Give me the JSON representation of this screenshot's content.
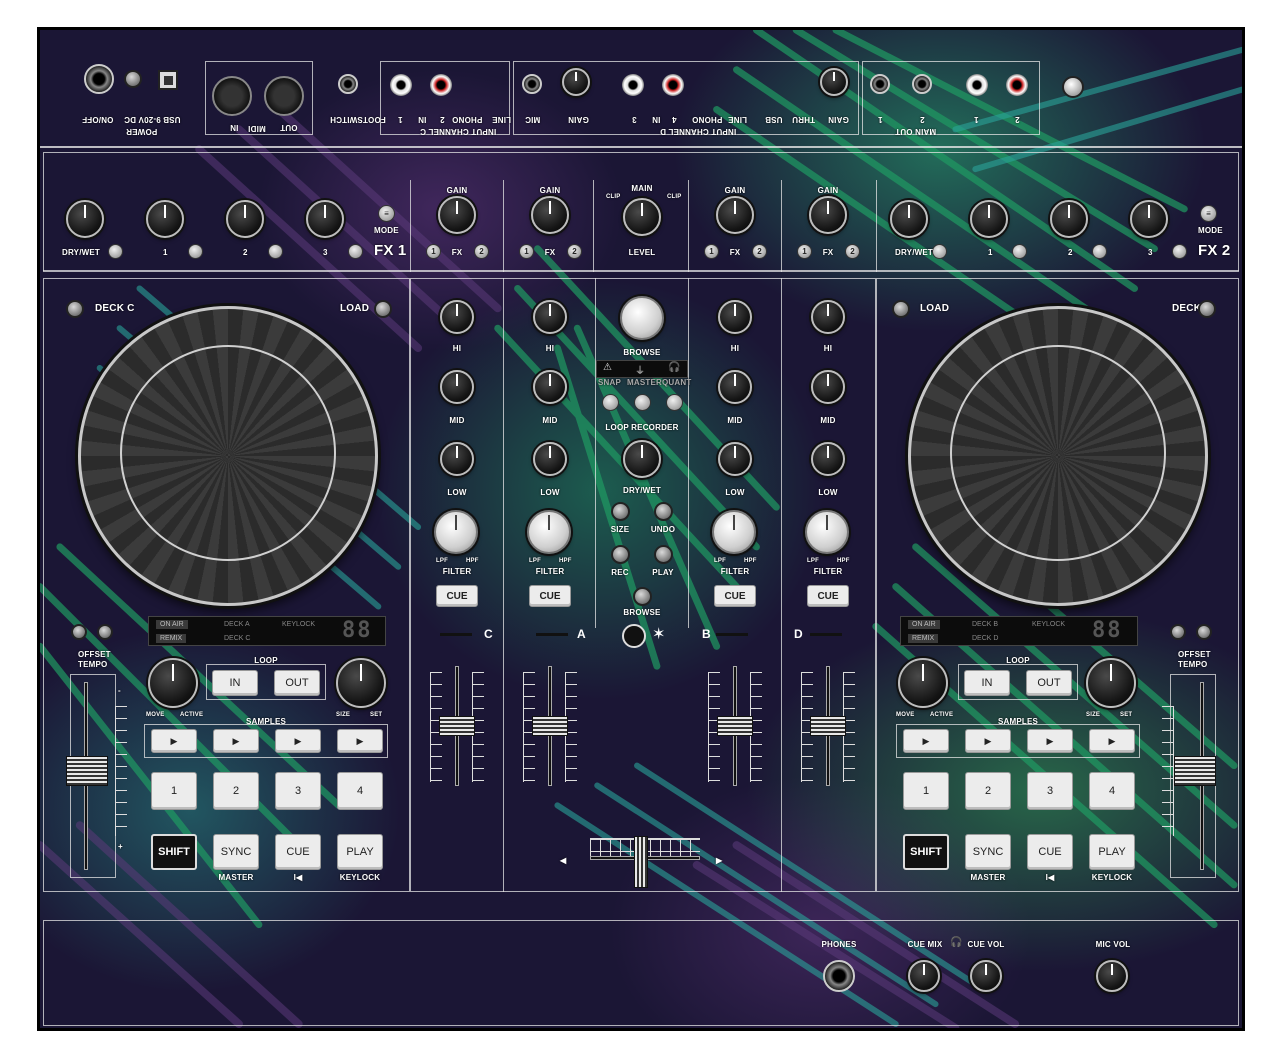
{
  "rear_panel": {
    "power": "POWER",
    "on_off": "ON/OFF",
    "dc": "9-20V DC",
    "usb": "USB",
    "midi": "MIDI",
    "midi_in": "IN",
    "midi_out": "OUT",
    "footswitch": "FOOTSWITCH",
    "input_c": "INPUT CHANNEL C",
    "input_c_labels": [
      "LINE",
      "PHONO",
      "2",
      "IN",
      "1"
    ],
    "mic": "MIC",
    "gain": "GAIN",
    "input_d": "INPUT CHANNEL D",
    "input_d_labels": [
      "3",
      "IN",
      "4",
      "PHONO",
      "LINE",
      "USB",
      "THRU"
    ],
    "gain_2": "GAIN",
    "main_out": "MAIN OUT",
    "out_1": "1",
    "out_2": "2",
    "rca_1": "1",
    "rca_2": "2"
  },
  "fx1": {
    "title": "FX 1",
    "dry_wet": "DRY/WET",
    "k1": "1",
    "k2": "2",
    "k3": "3",
    "mode": "MODE"
  },
  "fx2": {
    "title": "FX 2",
    "dry_wet": "DRY/WET",
    "k1": "1",
    "k2": "2",
    "k3": "3",
    "mode": "MODE"
  },
  "mixer": {
    "gain": "GAIN",
    "fx": "FX",
    "fx_1": "1",
    "fx_2": "2",
    "main": "MAIN",
    "clip": "CLIP",
    "level": "LEVEL",
    "hi": "HI",
    "mid": "MID",
    "low": "LOW",
    "lpf": "LPF",
    "hpf": "HPF",
    "filter": "FILTER",
    "cue": "CUE",
    "browse": "BROWSE",
    "snap": "SNAP",
    "master": "MASTER",
    "quant": "QUANT",
    "loop_recorder": "LOOP RECORDER",
    "dry_wet": "DRY/WET",
    "size": "SIZE",
    "undo": "UNDO",
    "rec": "REC",
    "play": "PLAY",
    "browse_2": "BROWSE",
    "channels": [
      "C",
      "A",
      "B",
      "D"
    ],
    "minus": "-",
    "plus": "+"
  },
  "deck_left": {
    "deck": "DECK C",
    "load": "LOAD",
    "on_air": "ON AIR",
    "remix": "REMIX",
    "deck_a": "DECK A",
    "deck_c": "DECK C",
    "keylock": "KEYLOCK",
    "display": "88",
    "offset": "OFFSET",
    "tempo": "TEMPO",
    "loop": "LOOP",
    "in": "IN",
    "out": "OUT",
    "move": "MOVE",
    "active": "ACTIVE",
    "size": "SIZE",
    "set": "SET",
    "samples": "SAMPLES",
    "play_glyph": "▶",
    "pads": [
      "1",
      "2",
      "3",
      "4"
    ],
    "shift": "SHIFT",
    "sync": "SYNC",
    "cue": "CUE",
    "play": "PLAY",
    "master": "MASTER",
    "cue_sub": "I◀",
    "keylock_sub": "KEYLOCK",
    "minus": "-",
    "plus": "+"
  },
  "deck_right": {
    "deck": "DECK D",
    "load": "LOAD",
    "on_air": "ON AIR",
    "remix": "REMIX",
    "deck_b": "DECK B",
    "deck_d": "DECK D",
    "keylock": "KEYLOCK",
    "display": "88",
    "offset": "OFFSET",
    "tempo": "TEMPO",
    "loop": "LOOP",
    "in": "IN",
    "out": "OUT",
    "move": "MOVE",
    "active": "ACTIVE",
    "size": "SIZE",
    "set": "SET",
    "samples": "SAMPLES",
    "play_glyph": "▶",
    "pads": [
      "1",
      "2",
      "3",
      "4"
    ],
    "shift": "SHIFT",
    "sync": "SYNC",
    "cue": "CUE",
    "play": "PLAY",
    "master": "MASTER",
    "cue_sub": "I◀",
    "keylock_sub": "KEYLOCK",
    "minus": "-",
    "plus": "+"
  },
  "front": {
    "phones": "PHONES",
    "cue_mix": "CUE MIX",
    "cue_vol": "CUE VOL",
    "mic_vol": "MIC VOL"
  },
  "crossfader": {
    "left_arrow": "◀",
    "right_arrow": "▶"
  },
  "colors": {
    "background": "#1b1635",
    "leaf_green": "#1f9a63",
    "leaf_teal": "#2aa39a",
    "leaf_purple": "#5b3a7a",
    "frame": "#000000"
  }
}
